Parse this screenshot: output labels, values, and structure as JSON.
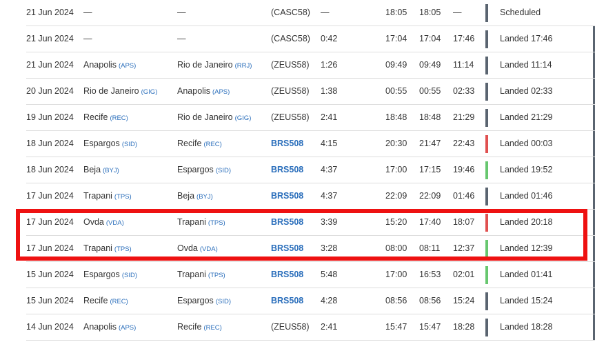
{
  "colors": {
    "link": "#2a6ebb",
    "bar_default": "#5a6470",
    "bar_late": "#e05050",
    "bar_ontime": "#67c76f",
    "highlight": "#ee1111"
  },
  "flights": [
    {
      "date": "21 Jun 2024",
      "from": "—",
      "from_code": "",
      "to": "—",
      "to_code": "",
      "flight": "(CASC58)",
      "flight_link": false,
      "duration": "—",
      "std": "18:05",
      "atd": "18:05",
      "sta": "—",
      "bar": "bar_default",
      "status": "Scheduled",
      "edge_icon": false
    },
    {
      "date": "21 Jun 2024",
      "from": "—",
      "from_code": "",
      "to": "—",
      "to_code": "",
      "flight": "(CASC58)",
      "flight_link": false,
      "duration": "0:42",
      "std": "17:04",
      "atd": "17:04",
      "sta": "17:46",
      "bar": "bar_default",
      "status": "Landed 17:46",
      "edge_icon": true
    },
    {
      "date": "21 Jun 2024",
      "from": "Anapolis",
      "from_code": "(APS)",
      "to": "Rio de Janeiro",
      "to_code": "(RRJ)",
      "flight": "(ZEUS58)",
      "flight_link": false,
      "duration": "1:26",
      "std": "09:49",
      "atd": "09:49",
      "sta": "11:14",
      "bar": "bar_default",
      "status": "Landed 11:14",
      "edge_icon": true
    },
    {
      "date": "20 Jun 2024",
      "from": "Rio de Janeiro",
      "from_code": "(GIG)",
      "to": "Anapolis",
      "to_code": "(APS)",
      "flight": "(ZEUS58)",
      "flight_link": false,
      "duration": "1:38",
      "std": "00:55",
      "atd": "00:55",
      "sta": "02:33",
      "bar": "bar_default",
      "status": "Landed 02:33",
      "edge_icon": true
    },
    {
      "date": "19 Jun 2024",
      "from": "Recife",
      "from_code": "(REC)",
      "to": "Rio de Janeiro",
      "to_code": "(GIG)",
      "flight": "(ZEUS58)",
      "flight_link": false,
      "duration": "2:41",
      "std": "18:48",
      "atd": "18:48",
      "sta": "21:29",
      "bar": "bar_default",
      "status": "Landed 21:29",
      "edge_icon": true
    },
    {
      "date": "18 Jun 2024",
      "from": "Espargos",
      "from_code": "(SID)",
      "to": "Recife",
      "to_code": "(REC)",
      "flight": "BRS508",
      "flight_link": true,
      "duration": "4:15",
      "std": "20:30",
      "atd": "21:47",
      "sta": "22:43",
      "bar": "bar_late",
      "status": "Landed 00:03",
      "edge_icon": true
    },
    {
      "date": "18 Jun 2024",
      "from": "Beja",
      "from_code": "(BYJ)",
      "to": "Espargos",
      "to_code": "(SID)",
      "flight": "BRS508",
      "flight_link": true,
      "duration": "4:37",
      "std": "17:00",
      "atd": "17:15",
      "sta": "19:46",
      "bar": "bar_ontime",
      "status": "Landed 19:52",
      "edge_icon": true
    },
    {
      "date": "17 Jun 2024",
      "from": "Trapani",
      "from_code": "(TPS)",
      "to": "Beja",
      "to_code": "(BYJ)",
      "flight": "BRS508",
      "flight_link": true,
      "duration": "4:37",
      "std": "22:09",
      "atd": "22:09",
      "sta": "01:46",
      "bar": "bar_default",
      "status": "Landed 01:46",
      "edge_icon": true
    },
    {
      "date": "17 Jun 2024",
      "from": "Ovda",
      "from_code": "(VDA)",
      "to": "Trapani",
      "to_code": "(TPS)",
      "flight": "BRS508",
      "flight_link": true,
      "duration": "3:39",
      "std": "15:20",
      "atd": "17:40",
      "sta": "18:07",
      "bar": "bar_late",
      "status": "Landed 20:18",
      "edge_icon": true
    },
    {
      "date": "17 Jun 2024",
      "from": "Trapani",
      "from_code": "(TPS)",
      "to": "Ovda",
      "to_code": "(VDA)",
      "flight": "BRS508",
      "flight_link": true,
      "duration": "3:28",
      "std": "08:00",
      "atd": "08:11",
      "sta": "12:37",
      "bar": "bar_ontime",
      "status": "Landed 12:39",
      "edge_icon": true
    },
    {
      "date": "15 Jun 2024",
      "from": "Espargos",
      "from_code": "(SID)",
      "to": "Trapani",
      "to_code": "(TPS)",
      "flight": "BRS508",
      "flight_link": true,
      "duration": "5:48",
      "std": "17:00",
      "atd": "16:53",
      "sta": "02:01",
      "bar": "bar_ontime",
      "status": "Landed 01:41",
      "edge_icon": true
    },
    {
      "date": "15 Jun 2024",
      "from": "Recife",
      "from_code": "(REC)",
      "to": "Espargos",
      "to_code": "(SID)",
      "flight": "BRS508",
      "flight_link": true,
      "duration": "4:28",
      "std": "08:56",
      "atd": "08:56",
      "sta": "15:24",
      "bar": "bar_default",
      "status": "Landed 15:24",
      "edge_icon": true
    },
    {
      "date": "14 Jun 2024",
      "from": "Anapolis",
      "from_code": "(APS)",
      "to": "Recife",
      "to_code": "(REC)",
      "flight": "(ZEUS58)",
      "flight_link": false,
      "duration": "2:41",
      "std": "15:47",
      "atd": "15:47",
      "sta": "18:28",
      "bar": "bar_default",
      "status": "Landed 18:28",
      "edge_icon": true
    }
  ]
}
